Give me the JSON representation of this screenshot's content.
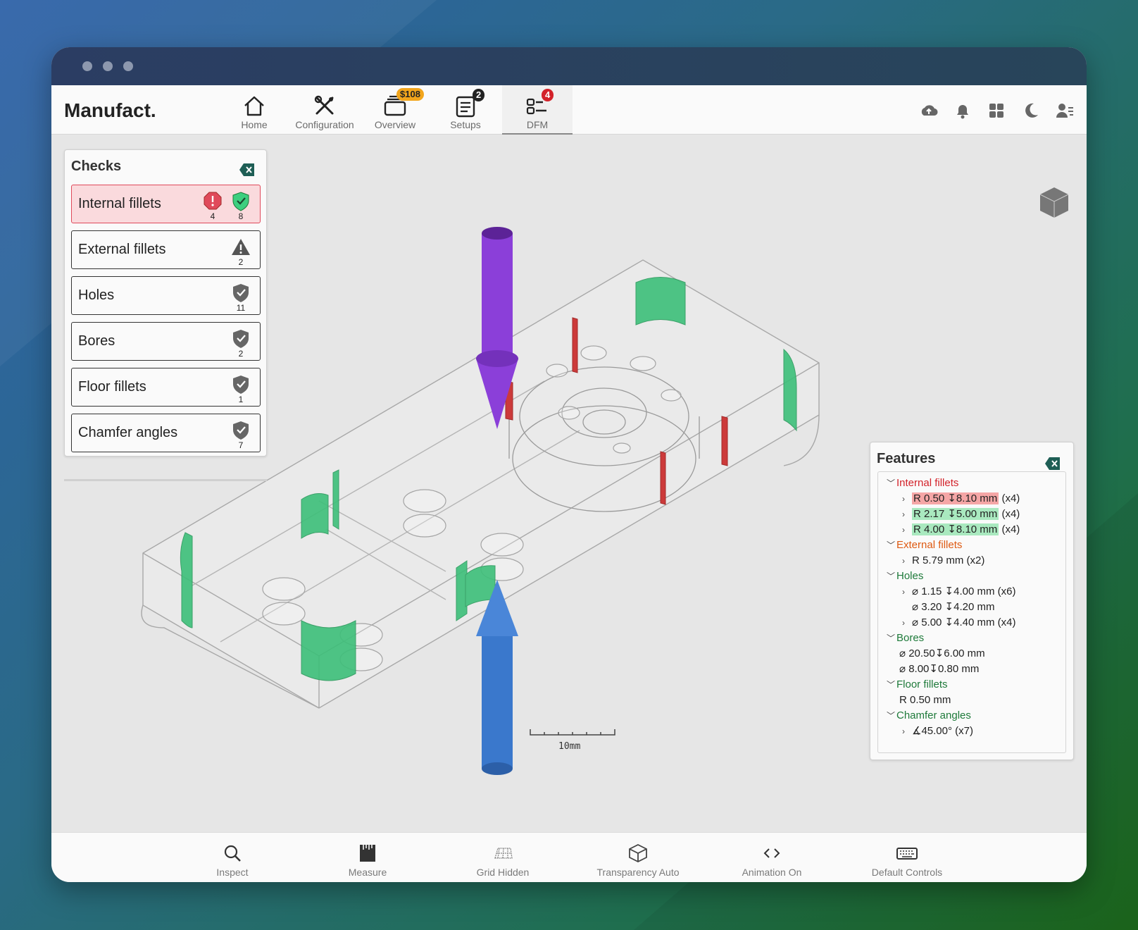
{
  "app": {
    "brand": "Manufact."
  },
  "nav": [
    {
      "label": "Home",
      "icon": "home-icon"
    },
    {
      "label": "Configuration",
      "icon": "tools-icon"
    },
    {
      "label": "Overview",
      "icon": "cards-icon",
      "badge": "$108"
    },
    {
      "label": "Setups",
      "icon": "clipboard-list-icon",
      "badge": "2"
    },
    {
      "label": "DFM",
      "icon": "checklist-icon",
      "badge": "4",
      "active": true
    }
  ],
  "right_icons": [
    "cloud-upload-icon",
    "bell-icon",
    "grid-icon",
    "moon-icon",
    "user-list-icon"
  ],
  "checks": {
    "title": "Checks",
    "items": [
      {
        "label": "Internal fillets",
        "error_count": "4",
        "ok_count": "8",
        "selected": true
      },
      {
        "label": "External fillets",
        "warn_count": "2"
      },
      {
        "label": "Holes",
        "ok_count": "11"
      },
      {
        "label": "Bores",
        "ok_count": "2"
      },
      {
        "label": "Floor fillets",
        "ok_count": "1"
      },
      {
        "label": "Chamfer angles",
        "ok_count": "7"
      }
    ]
  },
  "viewport": {
    "scale_label": "10mm"
  },
  "features": {
    "title": "Features",
    "groups": [
      {
        "label": "Internal fillets",
        "items": [
          "R 0.50 ↧8.10 mm",
          "R 2.17 ↧5.00 mm",
          "R 4.00 ↧8.10 mm"
        ],
        "counts": [
          "(x4)",
          "(x4)",
          "(x4)"
        ]
      },
      {
        "label": "External fillets",
        "items": [
          "R 5.79 mm"
        ],
        "counts": [
          "(x2)"
        ]
      },
      {
        "label": "Holes",
        "items": [
          "⌀ 1.15 ↧4.00 mm",
          "⌀ 3.20 ↧4.20 mm",
          "⌀ 5.00 ↧4.40 mm"
        ],
        "counts": [
          "(x6)",
          "",
          "(x4)"
        ]
      },
      {
        "label": "Bores",
        "items": [
          "⌀ 20.50↧6.00 mm",
          "⌀ 8.00↧0.80 mm"
        ]
      },
      {
        "label": "Floor fillets",
        "items": [
          "R 0.50 mm"
        ]
      },
      {
        "label": "Chamfer angles",
        "items": [
          "∡45.00°"
        ],
        "counts": [
          "(x7)"
        ]
      }
    ]
  },
  "toolbar": [
    {
      "label": "Inspect",
      "icon": "magnifier-icon"
    },
    {
      "label": "Measure",
      "icon": "ruler-icon"
    },
    {
      "label": "Grid Hidden",
      "icon": "grid-plane-icon"
    },
    {
      "label": "Transparency Auto",
      "icon": "cube-icon"
    },
    {
      "label": "Animation On",
      "icon": "code-brackets-icon"
    },
    {
      "label": "Default Controls",
      "icon": "keyboard-icon"
    }
  ],
  "colors": {
    "error": "#e0495a",
    "ok": "#2fbf6e",
    "accent_purple": "#8b3fd9",
    "accent_blue": "#3a78cc"
  }
}
